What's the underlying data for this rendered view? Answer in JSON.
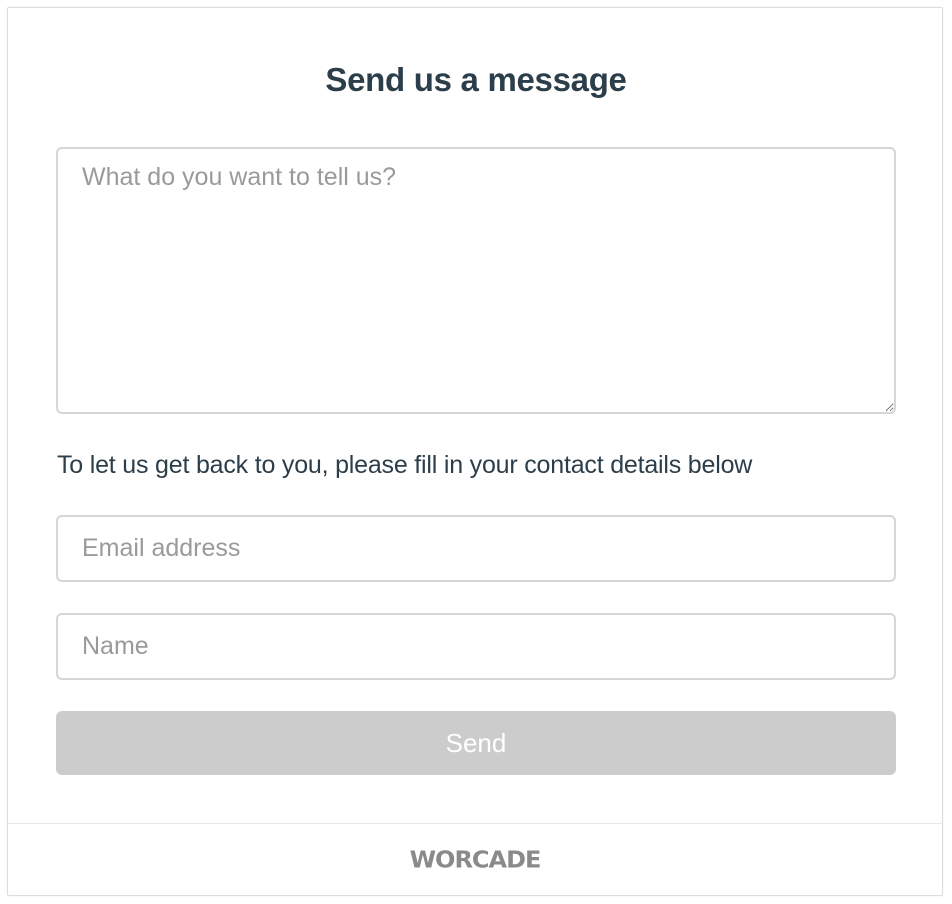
{
  "form": {
    "title": "Send us a message",
    "message_placeholder": "What do you want to tell us?",
    "message_value": "",
    "contact_hint": "To let us get back to you, please fill in your contact details below",
    "email_placeholder": "Email address",
    "email_value": "",
    "name_placeholder": "Name",
    "name_value": "",
    "send_label": "Send"
  },
  "footer": {
    "logo_text": "WORCADE"
  },
  "colors": {
    "title": "#2c3e4a",
    "placeholder": "#9a9a9a",
    "border": "#d6d6d6",
    "button_disabled_bg": "#cccccc",
    "button_text": "#ffffff",
    "logo": "#8a8a8a"
  }
}
